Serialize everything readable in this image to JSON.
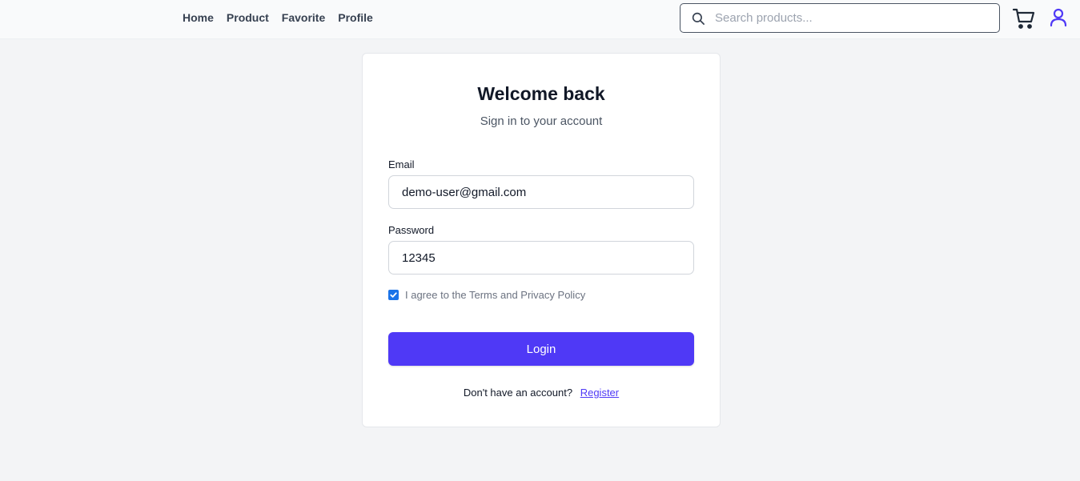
{
  "nav": {
    "items": [
      {
        "label": "Home"
      },
      {
        "label": "Product"
      },
      {
        "label": "Favorite"
      },
      {
        "label": "Profile"
      }
    ]
  },
  "search": {
    "placeholder": "Search products...",
    "value": ""
  },
  "icons": {
    "search": "search-icon",
    "cart": "cart-icon",
    "user": "user-icon"
  },
  "colors": {
    "accent": "#4f39f6",
    "page_bg": "#f3f4f6",
    "checkbox": "#1a73e8"
  },
  "login": {
    "title": "Welcome back",
    "subtitle": "Sign in to your account",
    "email_label": "Email",
    "email_value": "demo-user@gmail.com",
    "password_label": "Password",
    "password_value": "12345",
    "agree_text": "I agree to the Terms and Privacy Policy",
    "agree_checked": true,
    "button_label": "Login",
    "no_account_text": "Don't have an account?",
    "register_link": "Register"
  }
}
